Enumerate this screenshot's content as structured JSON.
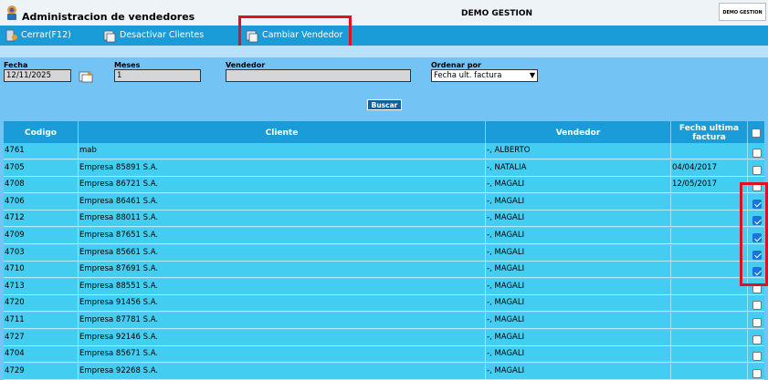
{
  "app": {
    "title": "Administracion de vendedores",
    "company": "DEMO GESTION",
    "corner_logo": "DEMO GESTION"
  },
  "toolbar": {
    "close_label": "Cerrar(F12)",
    "deactivate_label": "Desactivar Clientes",
    "change_label": "Cambiar Vendedor"
  },
  "filters": {
    "fecha_label": "Fecha",
    "fecha_value": "12/11/2025",
    "meses_label": "Meses",
    "meses_value": "1",
    "vendedor_label": "Vendedor",
    "vendedor_value": "",
    "ordenar_label": "Ordenar por",
    "ordenar_value": "Fecha ult. factura",
    "search_label": "Buscar"
  },
  "table": {
    "headers": {
      "codigo": "Codigo",
      "cliente": "Cliente",
      "vendedor": "Vendedor",
      "fecha": "Fecha ultima factura"
    },
    "rows": [
      {
        "codigo": "4761",
        "cliente": "mab",
        "vendedor": "-, ALBERTO",
        "fecha": "",
        "checked": false
      },
      {
        "codigo": "4705",
        "cliente": "Empresa 85891 S.A.",
        "vendedor": "-, NATALIA",
        "fecha": "04/04/2017",
        "checked": false
      },
      {
        "codigo": "4708",
        "cliente": "Empresa 86721 S.A.",
        "vendedor": "-, MAGALI",
        "fecha": "12/05/2017",
        "checked": false
      },
      {
        "codigo": "4706",
        "cliente": "Empresa 86461 S.A.",
        "vendedor": "-, MAGALI",
        "fecha": "",
        "checked": true
      },
      {
        "codigo": "4712",
        "cliente": "Empresa 88011 S.A.",
        "vendedor": "-, MAGALI",
        "fecha": "",
        "checked": true
      },
      {
        "codigo": "4709",
        "cliente": "Empresa 87651 S.A.",
        "vendedor": "-, MAGALI",
        "fecha": "",
        "checked": true
      },
      {
        "codigo": "4703",
        "cliente": "Empresa 85661 S.A.",
        "vendedor": "-, MAGALI",
        "fecha": "",
        "checked": true
      },
      {
        "codigo": "4710",
        "cliente": "Empresa 87691 S.A.",
        "vendedor": "-, MAGALI",
        "fecha": "",
        "checked": true
      },
      {
        "codigo": "4713",
        "cliente": "Empresa 88551 S.A.",
        "vendedor": "-, MAGALI",
        "fecha": "",
        "checked": false
      },
      {
        "codigo": "4720",
        "cliente": "Empresa 91456 S.A.",
        "vendedor": "-, MAGALI",
        "fecha": "",
        "checked": false
      },
      {
        "codigo": "4711",
        "cliente": "Empresa 87781 S.A.",
        "vendedor": "-, MAGALI",
        "fecha": "",
        "checked": false
      },
      {
        "codigo": "4727",
        "cliente": "Empresa 92146 S.A.",
        "vendedor": "-, MAGALI",
        "fecha": "",
        "checked": false
      },
      {
        "codigo": "4704",
        "cliente": "Empresa 85671 S.A.",
        "vendedor": "-, MAGALI",
        "fecha": "",
        "checked": false
      },
      {
        "codigo": "4729",
        "cliente": "Empresa 92268 S.A.",
        "vendedor": "-, MAGALI",
        "fecha": "",
        "checked": false
      }
    ]
  },
  "colors": {
    "background": "#73c4f5",
    "toolbar": "#1a9cd9",
    "row": "#43cdf1",
    "highlight": "#e01020"
  }
}
